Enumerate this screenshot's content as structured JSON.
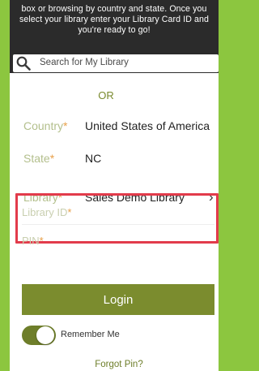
{
  "intro": {
    "line1": "box or browsing by country and state. Once you",
    "line2": "select your library enter your Library Card ID and",
    "line3": "you're ready to go!"
  },
  "search": {
    "placeholder": "Search for My Library",
    "icon": "search-icon"
  },
  "separator": "OR",
  "fields": {
    "country": {
      "label": "Country",
      "required_mark": "*",
      "value": "United States of America"
    },
    "state": {
      "label": "State",
      "required_mark": "*",
      "value": "NC"
    },
    "library": {
      "label": "Library",
      "required_mark": "*",
      "value": "Sales Demo Library",
      "chevron": "›"
    }
  },
  "credentials": {
    "library_id": {
      "label": "Library ID",
      "required_mark": "*"
    },
    "pin": {
      "label": "PIN",
      "required_mark": "*"
    }
  },
  "login_label": "Login",
  "remember_me": {
    "label": "Remember Me",
    "checked": true
  },
  "forgot_pin": "Forgot Pin?",
  "colors": {
    "background": "#8cc63f",
    "accent": "#7b8c2e",
    "highlight_box": "#e23b4b",
    "dark_header": "#2b2b2b"
  }
}
